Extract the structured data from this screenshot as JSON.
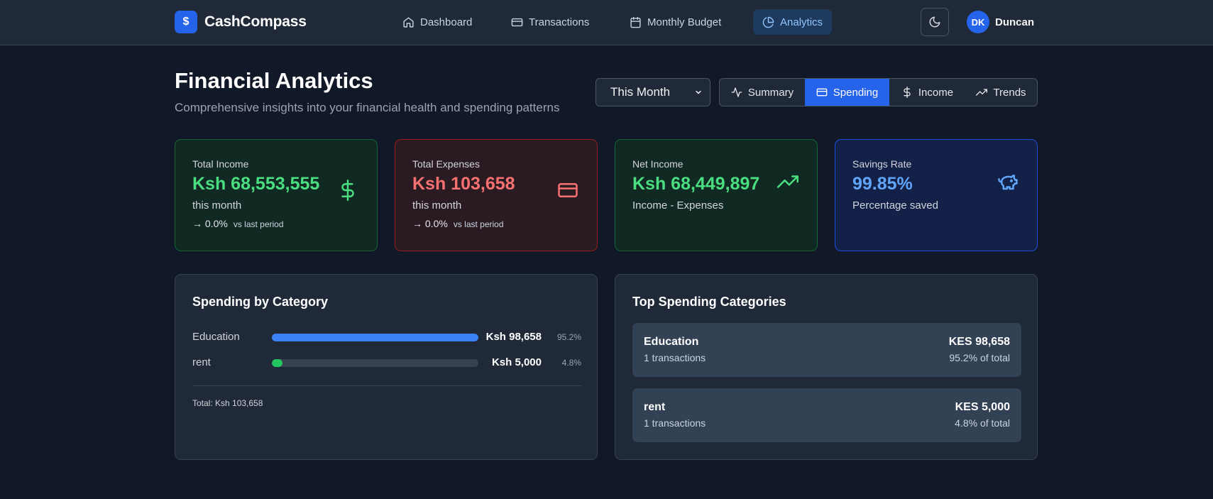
{
  "nav": {
    "brand": "CashCompass",
    "brand_logo_symbol": "$",
    "links": [
      {
        "label": "Dashboard",
        "icon": "home-icon"
      },
      {
        "label": "Transactions",
        "icon": "credit-card-icon"
      },
      {
        "label": "Monthly Budget",
        "icon": "calendar-icon"
      },
      {
        "label": "Analytics",
        "icon": "pie-chart-icon",
        "active": true
      }
    ],
    "theme_toggle_icon": "moon-icon",
    "user": {
      "initials": "DK",
      "name": "Duncan"
    }
  },
  "header": {
    "title": "Financial Analytics",
    "subtitle": "Comprehensive insights into your financial health and spending patterns"
  },
  "controls": {
    "period": "This Month",
    "period_options": [
      "This Month"
    ],
    "tabs": [
      {
        "label": "Summary",
        "icon": "activity-icon"
      },
      {
        "label": "Spending",
        "icon": "credit-card-icon",
        "active": true
      },
      {
        "label": "Income",
        "icon": "dollar-icon"
      },
      {
        "label": "Trends",
        "icon": "trending-up-icon"
      }
    ]
  },
  "stats": {
    "income": {
      "label": "Total Income",
      "value": "Ksh 68,553,555",
      "sub": "this month",
      "change": "→ 0.0%",
      "vs": "vs last period",
      "icon": "dollar-icon",
      "color": "#4ade80"
    },
    "expenses": {
      "label": "Total Expenses",
      "value": "Ksh 103,658",
      "sub": "this month",
      "change": "→ 0.0%",
      "vs": "vs last period",
      "icon": "credit-card-icon",
      "color": "#f87171"
    },
    "net": {
      "label": "Net Income",
      "value": "Ksh 68,449,897",
      "sub": "Income - Expenses",
      "icon": "trending-up-icon",
      "color": "#4ade80"
    },
    "savings": {
      "label": "Savings Rate",
      "value": "99.85%",
      "sub": "Percentage saved",
      "icon": "piggy-bank-icon",
      "color": "#60a5fa"
    }
  },
  "spending_by_category": {
    "title": "Spending by Category",
    "items": [
      {
        "name": "Education",
        "amount": "Ksh 98,658",
        "pct": "95.2%",
        "fraction": 1.0,
        "color": "#3b82f6"
      },
      {
        "name": "rent",
        "amount": "Ksh 5,000",
        "pct": "4.8%",
        "fraction": 0.05,
        "color": "#22c55e"
      }
    ],
    "total": "Total: Ksh 103,658"
  },
  "top_spending": {
    "title": "Top Spending Categories",
    "items": [
      {
        "name": "Education",
        "count": "1 transactions",
        "amount": "KES 98,658",
        "share": "95.2% of total"
      },
      {
        "name": "rent",
        "count": "1 transactions",
        "amount": "KES 5,000",
        "share": "4.8% of total"
      }
    ]
  }
}
